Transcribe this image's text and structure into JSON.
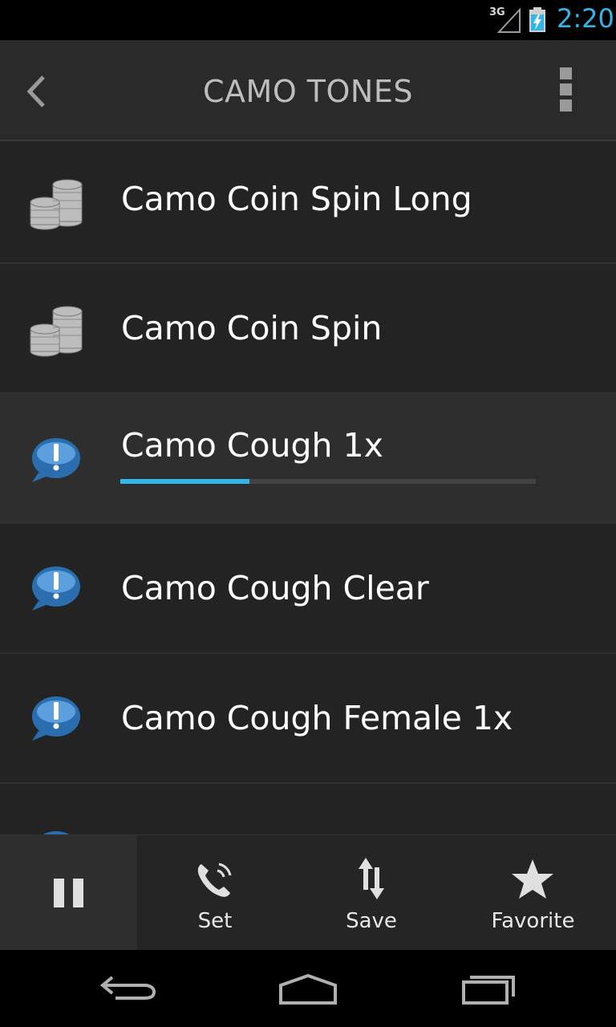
{
  "status_bar": {
    "network": "3G",
    "time": "2:20",
    "time_color": "#33b5e5"
  },
  "action_bar": {
    "title": "CAMO TONES"
  },
  "list": {
    "items": [
      {
        "label": "Camo Coin Spin Long",
        "icon": "coins-icon",
        "playing": false
      },
      {
        "label": "Camo Coin Spin",
        "icon": "coins-icon",
        "playing": false
      },
      {
        "label": "Camo Cough 1x",
        "icon": "exclamation-bubble-icon",
        "playing": true,
        "progress": 0.31
      },
      {
        "label": "Camo Cough Clear",
        "icon": "exclamation-bubble-icon",
        "playing": false
      },
      {
        "label": "Camo Cough Female 1x",
        "icon": "exclamation-bubble-icon",
        "playing": false
      }
    ]
  },
  "toolbar": {
    "pause_icon": "pause-icon",
    "set_label": "Set",
    "set_icon": "phone-ringing-icon",
    "save_label": "Save",
    "save_icon": "up-down-arrows-icon",
    "favorite_label": "Favorite",
    "favorite_icon": "star-icon"
  },
  "nav_bar": {
    "back_icon": "back-icon",
    "home_icon": "home-icon",
    "recents_icon": "recents-icon"
  }
}
